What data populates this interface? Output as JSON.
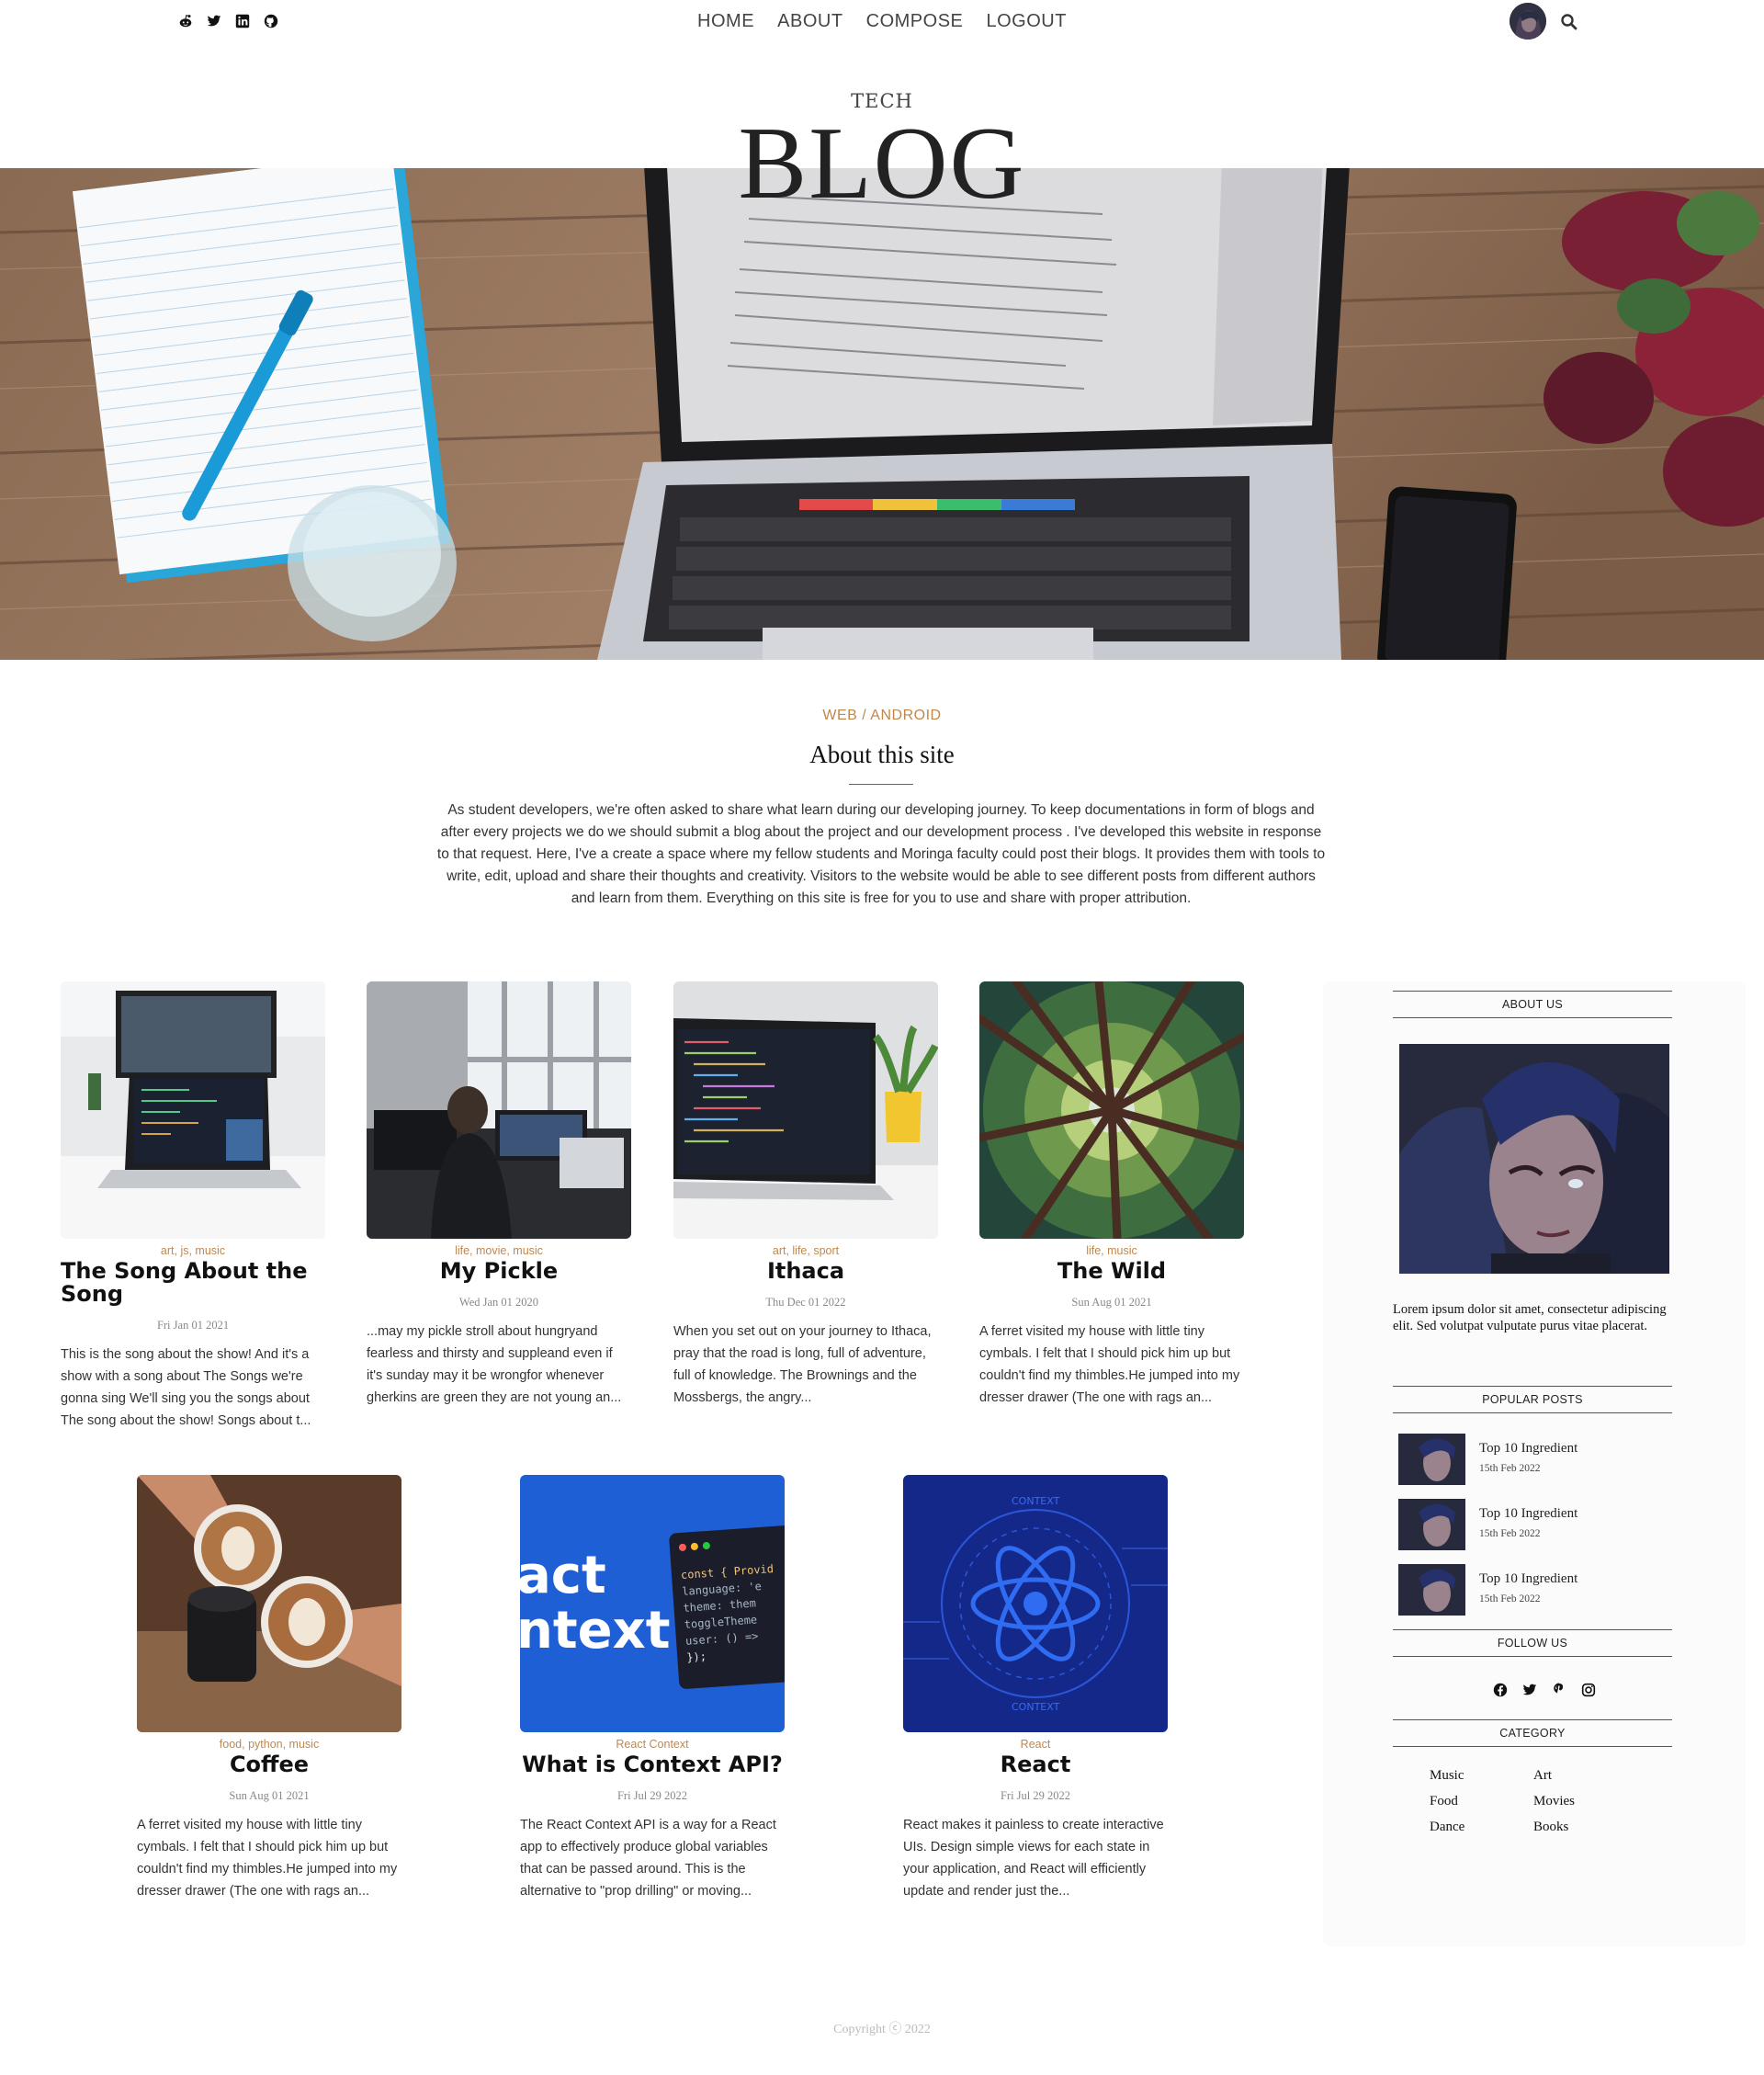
{
  "nav": {
    "social": [
      "reddit-icon",
      "twitter-icon",
      "linkedin-icon",
      "github-icon"
    ],
    "links": [
      "HOME",
      "ABOUT",
      "COMPOSE",
      "LOGOUT"
    ]
  },
  "header": {
    "tech": "TECH",
    "blog": "BLOG"
  },
  "about": {
    "kicker": "WEB / ANDROID",
    "title": "About this site",
    "text": "As student developers, we're often asked to share what learn during our developing journey. To keep documentations in form of blogs and after every projects we do we should submit a blog about the project and our development process . I've developed this website in response to that request. Here, I've a create a space where my fellow students and Moringa faculty could post their blogs. It provides them with tools to write, edit, upload and share their thoughts and creativity. Visitors to the website would be able to see different posts from different authors and learn from them. Everything on this site is free for you to use and share with proper attribution."
  },
  "posts": [
    {
      "tags": "art, js, music",
      "title": "The Song About the Song",
      "date": "Fri Jan 01 2021",
      "excerpt": "This is the song about the show! And it's a show with a song about The Songs we're gonna sing We'll sing you the songs about The song about the show! Songs about t..."
    },
    {
      "tags": "life, movie, music",
      "title": "My Pickle",
      "date": "Wed Jan 01 2020",
      "excerpt": "...may my pickle stroll about hungryand fearless and thirsty and suppleand even if it's sunday may it be wrongfor whenever gherkins are green they are not young an..."
    },
    {
      "tags": "art, life, sport",
      "title": "Ithaca",
      "date": "Thu Dec 01 2022",
      "excerpt": "When you set out on your journey to Ithaca, pray that the road is long, full of adventure, full of knowledge. The Brownings and the Mossbergs, the angry..."
    },
    {
      "tags": "life, music",
      "title": "The Wild",
      "date": "Sun Aug 01 2021",
      "excerpt": "A ferret visited my house with little tiny cymbals. I felt that I should pick him up but couldn't find my thimbles.He jumped into my dresser drawer (The one with rags an..."
    },
    {
      "tags": "food, python, music",
      "title": "Coffee",
      "date": "Sun Aug 01 2021",
      "excerpt": "A ferret visited my house with little tiny cymbals. I felt that I should pick him up but couldn't find my thimbles.He jumped into my dresser drawer (The one with rags an..."
    },
    {
      "tags": "React   Context",
      "title": "What is Context API?",
      "date": "Fri Jul 29 2022",
      "excerpt": "The React Context API is a way for a React app to effectively produce global variables that can be passed around. This is the alternative to \"prop drilling\" or moving..."
    },
    {
      "tags": "React",
      "title": "React",
      "date": "Fri Jul 29 2022",
      "excerpt": "React makes it painless to create interactive UIs. Design simple views for each state in your application, and React will efficiently update and render just the..."
    }
  ],
  "context_card": {
    "headline": [
      "act",
      "ntext"
    ],
    "code": [
      "const { Provid",
      "  language: 'e",
      "  theme: them",
      "  toggleTheme",
      "  user: () =>",
      "});"
    ]
  },
  "react_card": {
    "ring_text": "CONTEXT"
  },
  "sidebar": {
    "about_heading": "ABOUT US",
    "lorem": "Lorem ipsum dolor sit amet, consectetur adipiscing elit. Sed volutpat vulputate purus vitae placerat.",
    "popular_heading": "POPULAR POSTS",
    "popular": [
      {
        "title": "Top 10 Ingredient",
        "date": "15th Feb 2022"
      },
      {
        "title": "Top 10 Ingredient",
        "date": "15th Feb 2022"
      },
      {
        "title": "Top 10 Ingredient",
        "date": "15th Feb 2022"
      }
    ],
    "follow_heading": "FOLLOW US",
    "follow_icons": [
      "facebook-icon",
      "twitter-icon",
      "pinterest-icon",
      "instagram-icon"
    ],
    "category_heading": "CATEGORY",
    "categories": [
      "Music",
      "Art",
      "Food",
      "Movies",
      "Dance",
      "Books"
    ]
  },
  "footer": {
    "copyright": "Copyright ⓒ 2022"
  },
  "colors": {
    "accent": "#c0874e",
    "text": "#333333"
  }
}
